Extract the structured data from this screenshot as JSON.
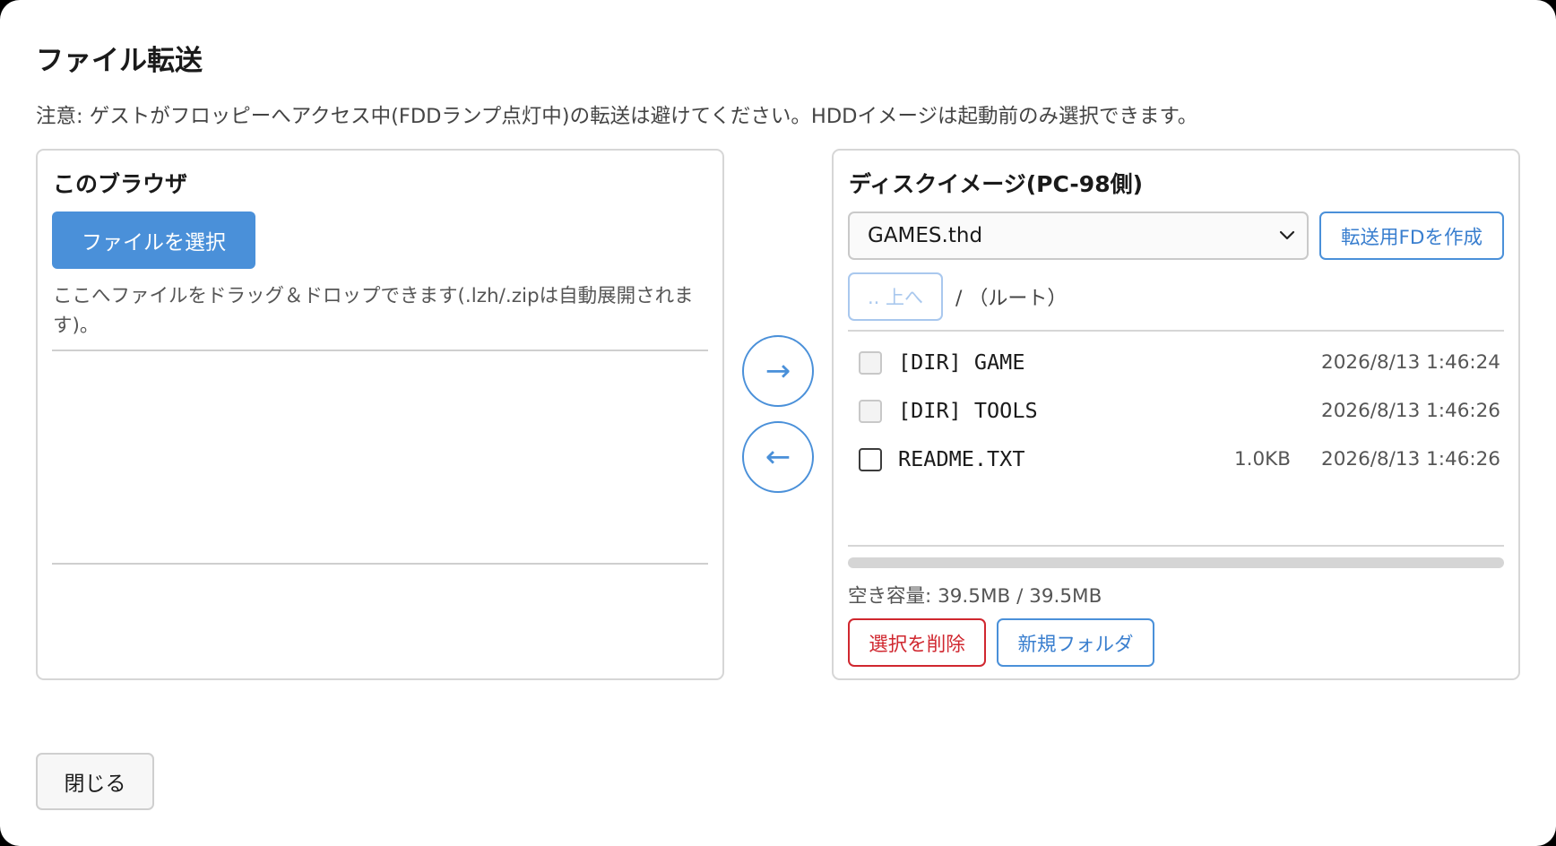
{
  "dialog": {
    "title": "ファイル転送",
    "notice": "注意: ゲストがフロッピーへアクセス中(FDDランプ点灯中)の転送は避けてください。HDDイメージは起動前のみ選択できます。"
  },
  "local_panel": {
    "title": "このブラウザ",
    "choose_file_label": "ファイルを選択",
    "drop_hint": "ここへファイルをドラッグ＆ドロップできます(.lzh/.zipは自動展開されます)。"
  },
  "transfer": {
    "to_disk_icon": "→",
    "to_browser_icon": "←"
  },
  "disk_panel": {
    "title": "ディスクイメージ(PC-98側)",
    "selected_image": "GAMES.thd",
    "create_fd_label": "転送用FDを作成",
    "up_label": ".. 上へ",
    "path": "/ （ルート）",
    "files": [
      {
        "name": "[DIR] GAME",
        "size": "",
        "date": "2026/8/13 1:46:24",
        "is_dir": true
      },
      {
        "name": "[DIR] TOOLS",
        "size": "",
        "date": "2026/8/13 1:46:26",
        "is_dir": true
      },
      {
        "name": "README.TXT",
        "size": "1.0KB",
        "date": "2026/8/13 1:46:26",
        "is_dir": false
      }
    ],
    "used_fraction": 0,
    "free_space": "空き容量: 39.5MB / 39.5MB",
    "delete_label": "選択を削除",
    "new_folder_label": "新規フォルダ"
  },
  "footer": {
    "close_label": "閉じる"
  },
  "colors": {
    "accent": "#4a90d9",
    "danger": "#d0272f"
  }
}
